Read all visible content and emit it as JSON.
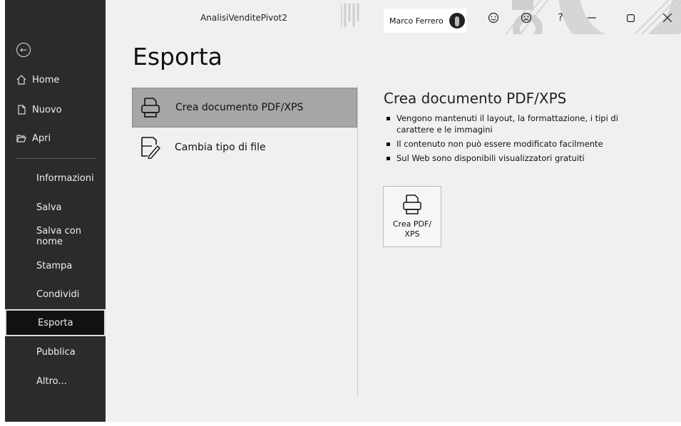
{
  "window": {
    "title": "AnalisiVenditePivot2",
    "user_name": "Marco Ferrero",
    "buttons": [
      "smiley-icon",
      "frown-icon",
      "help-icon",
      "minimize-icon",
      "restore-icon",
      "close-icon"
    ],
    "help_label": "?"
  },
  "sidebar": {
    "top_items": [
      {
        "label": "Home",
        "icon": "home-icon"
      },
      {
        "label": "Nuovo",
        "icon": "new-document-icon"
      },
      {
        "label": "Apri",
        "icon": "folder-open-icon"
      }
    ],
    "items": [
      {
        "label": "Informazioni"
      },
      {
        "label": "Salva"
      },
      {
        "label": "Salva con nome"
      },
      {
        "label": "Stampa"
      },
      {
        "label": "Condividi"
      },
      {
        "label": "Esporta",
        "active": true
      },
      {
        "label": "Pubblica"
      },
      {
        "label": "Altro..."
      }
    ]
  },
  "main": {
    "title": "Esporta",
    "options": [
      {
        "label": "Crea documento PDF/XPS",
        "icon": "pdf-printer-icon",
        "selected": true
      },
      {
        "label": "Cambia tipo di file",
        "icon": "change-file-type-icon",
        "selected": false
      }
    ],
    "details": {
      "title": "Crea documento PDF/XPS",
      "bullets": [
        "Vengono mantenuti il layout, la formattazione, i tipi di carattere e le immagini",
        "Il contenuto non può essere modificato facilmente",
        "Sul Web sono disponibili visualizzatori gratuiti"
      ],
      "button_label_1": "Crea PDF/",
      "button_label_2": "XPS"
    }
  },
  "colors": {
    "sidebar_bg": "#2b2b2b",
    "main_bg": "#f0f0f0",
    "selected_option_bg": "#a6a6a6"
  }
}
